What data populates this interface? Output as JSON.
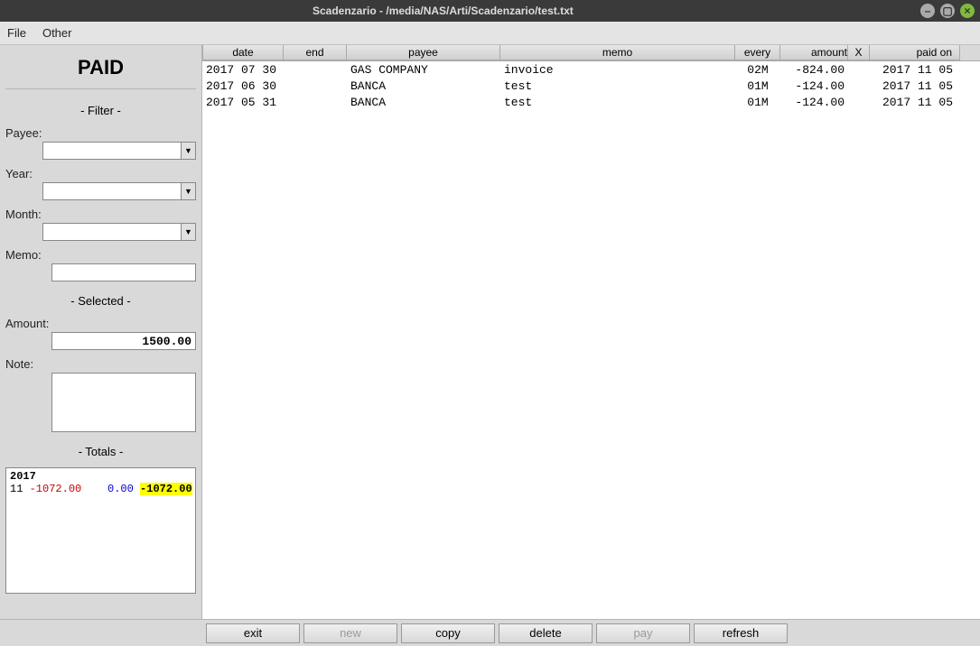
{
  "window": {
    "title": "Scadenzario - /media/NAS/Arti/Scadenzario/test.txt"
  },
  "menu": {
    "file": "File",
    "other": "Other"
  },
  "sidebar": {
    "title": "PAID",
    "filter_hdr": "- Filter -",
    "payee_lbl": "Payee:",
    "year_lbl": "Year:",
    "month_lbl": "Month:",
    "memo_lbl": "Memo:",
    "selected_hdr": "- Selected -",
    "amount_lbl": "Amount:",
    "amount_val": "1500.00",
    "note_lbl": "Note:",
    "totals_hdr": "- Totals -"
  },
  "totals": {
    "year": "2017",
    "month": "11",
    "expense": "-1072.00",
    "income": "0.00",
    "net": "-1072.00"
  },
  "columns": {
    "date": "date",
    "end": "end",
    "payee": "payee",
    "memo": "memo",
    "every": "every",
    "amount": "amount",
    "x": "X",
    "paidon": "paid on"
  },
  "rows": [
    {
      "date": "2017 07 30",
      "end": "",
      "payee": "GAS COMPANY",
      "memo": "invoice",
      "every": "02M",
      "amount": "-824.00",
      "x": "",
      "paidon": "2017 11 05"
    },
    {
      "date": "2017 06 30",
      "end": "",
      "payee": "BANCA",
      "memo": "test",
      "every": "01M",
      "amount": "-124.00",
      "x": "",
      "paidon": "2017 11 05"
    },
    {
      "date": "2017 05 31",
      "end": "",
      "payee": "BANCA",
      "memo": "test",
      "every": "01M",
      "amount": "-124.00",
      "x": "",
      "paidon": "2017 11 05"
    }
  ],
  "buttons": {
    "exit": "exit",
    "new": "new",
    "copy": "copy",
    "delete": "delete",
    "pay": "pay",
    "refresh": "refresh"
  }
}
